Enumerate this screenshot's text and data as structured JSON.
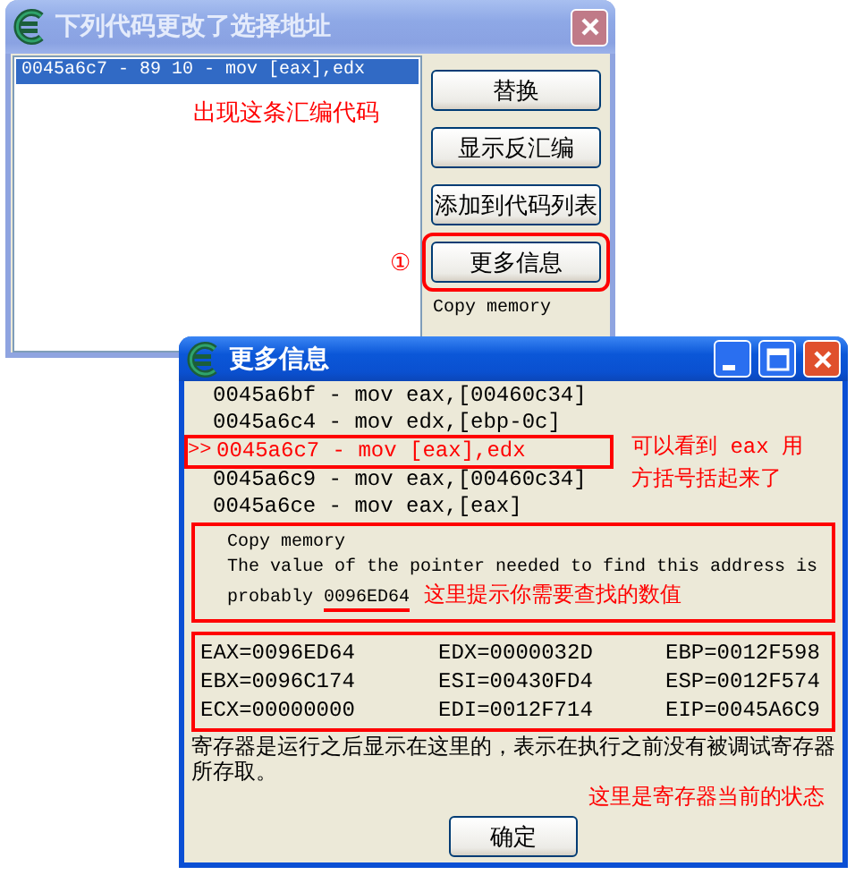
{
  "change_window": {
    "title": "下列代码更改了选择地址",
    "code_rows": [
      {
        "text": "0045a6c7 - 89 10 - mov [eax],edx",
        "selected": true
      }
    ],
    "annotation": "出现这条汇编代码",
    "step_marker": "①",
    "buttons": [
      {
        "label": "替换",
        "highlighted": false
      },
      {
        "label": "显示反汇编",
        "highlighted": false
      },
      {
        "label": "添加到代码列表",
        "highlighted": false
      },
      {
        "label": "更多信息",
        "highlighted": true
      }
    ],
    "status": "Copy memory"
  },
  "info_window": {
    "title": "更多信息",
    "disassembly": [
      {
        "text": "0045a6bf - mov eax,[00460c34]",
        "current": false
      },
      {
        "text": "0045a6c4 - mov edx,[ebp-0c]",
        "current": false
      },
      {
        "text": "0045a6c7 - mov [eax],edx",
        "current": true,
        "marker": ">>"
      },
      {
        "text": "0045a6c9 - mov eax,[00460c34]",
        "current": false
      },
      {
        "text": "0045a6ce - mov eax,[eax]",
        "current": false
      }
    ],
    "line_annotation": "可以看到 eax 用方括号括起来了",
    "pointer_lines": [
      "Copy memory",
      "The value of the pointer needed to find this address is"
    ],
    "pointer_prefix": "probably",
    "pointer_value": "0096ED64",
    "value_annotation": "这里提示你需要查找的数值",
    "registers": [
      "EAX=0096ED64",
      "EDX=0000032D",
      "EBP=0012F598",
      "EBX=0096C174",
      "ESI=00430FD4",
      "ESP=0012F574",
      "ECX=00000000",
      "EDI=0012F714",
      "EIP=0045A6C9"
    ],
    "note": "寄存器是运行之后显示在这里的，表示在执行之前没有被调试寄存器所存取。",
    "register_annotation": "这里是寄存器当前的状态",
    "ok_button": "确定"
  }
}
